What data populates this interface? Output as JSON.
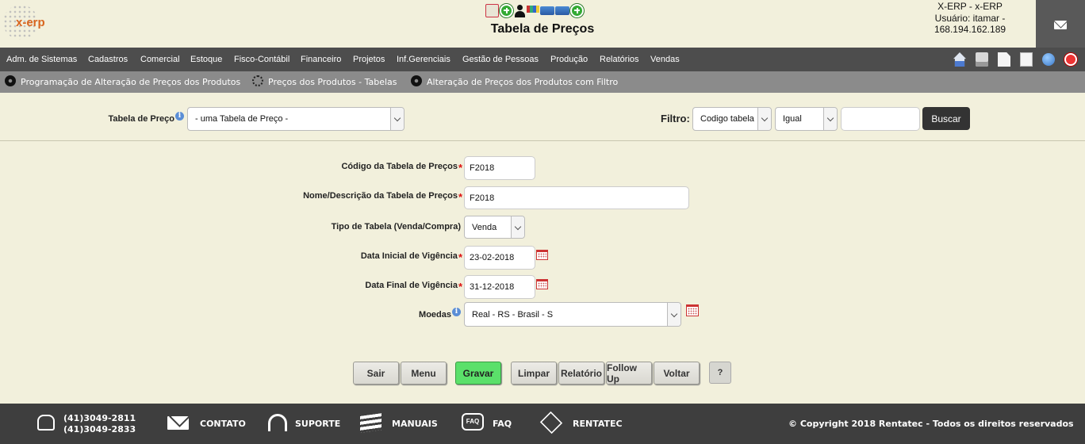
{
  "header": {
    "logo_text": "x-erp",
    "title": "Tabela de Preços",
    "user_lines": [
      "X-ERP - x-ERP",
      "Usuário: itamar -",
      "168.194.162.189"
    ],
    "toolbar_icons": [
      "report-icon",
      "add-icon",
      "user-icon",
      "chart-icon",
      "card-icon",
      "card-icon",
      "add-icon"
    ]
  },
  "nav": {
    "items": [
      "Adm. de Sistemas",
      "Cadastros",
      "Comercial",
      "Estoque",
      "Fisco-Contábil",
      "Financeiro",
      "Projetos",
      "Inf.Gerenciais",
      "Gestão de Pessoas",
      "Produção",
      "Relatórios",
      "Vendas"
    ],
    "right_icons": [
      "home-icon",
      "print-icon",
      "document-icon",
      "document-icon",
      "globe-icon",
      "power-icon"
    ]
  },
  "subnav": {
    "items": [
      "Programação de Alteração de Preços dos Produtos",
      "Preços dos Produtos - Tabelas",
      "Alteração de Preços dos Produtos com Filtro"
    ]
  },
  "filter": {
    "tabela_label": "Tabela de Preço",
    "tabela_value": "- uma Tabela de Preço -",
    "filtro_label": "Filtro:",
    "campo_value": "Codigo tabela",
    "operador_value": "Igual",
    "search_value": "",
    "buscar_label": "Buscar"
  },
  "form": {
    "codigo_label": "Código da Tabela de Preços",
    "codigo_value": "F2018",
    "nome_label": "Nome/Descrição da Tabela de Preços",
    "nome_value": "F2018",
    "tipo_label": "Tipo de Tabela (Venda/Compra)",
    "tipo_value": "Venda",
    "data_inicial_label": "Data Inicial de Vigência",
    "data_inicial_value": "23-02-2018",
    "data_final_label": "Data Final de Vigência",
    "data_final_value": "31-12-2018",
    "moedas_label": "Moedas",
    "moedas_value": "Real - RS - Brasil - S",
    "required_mark": "*",
    "info_mark": "i"
  },
  "buttons": {
    "sair": "Sair",
    "menu": "Menu",
    "gravar": "Gravar",
    "limpar": "Limpar",
    "relatorio": "Relatório",
    "followup": "Follow Up",
    "voltar": "Voltar",
    "help": "?"
  },
  "footer": {
    "phone1": "(41)3049-2811",
    "phone2": "(41)3049-2833",
    "contato": "CONTATO",
    "suporte": "SUPORTE",
    "manuais": "MANUAIS",
    "faq": "FAQ",
    "faq_icon_text": "FAQ",
    "rentatec": "RENTATEC",
    "copyright": "© Copyright 2018 Rentatec - Todos os direitos reservados"
  },
  "colors": {
    "background": "#f2f0dc",
    "nav": "#4d4d4d",
    "subnav": "#8b8b8b",
    "footer": "#3e3e3e",
    "save_button": "#5be06a",
    "required": "#dd1111"
  }
}
